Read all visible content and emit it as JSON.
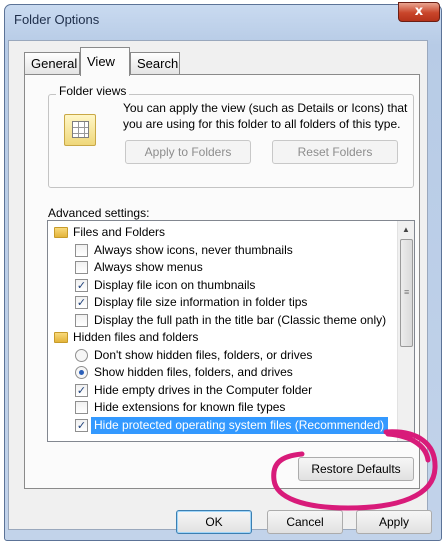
{
  "window": {
    "title": "Folder Options",
    "close_glyph": "x"
  },
  "tabs": [
    {
      "label": "General"
    },
    {
      "label": "View"
    },
    {
      "label": "Search"
    }
  ],
  "folder_views": {
    "legend": "Folder views",
    "description": "You can apply the view (such as Details or Icons) that you are using for this folder to all folders of this type.",
    "apply_button": "Apply to Folders",
    "reset_button": "Reset Folders"
  },
  "advanced": {
    "label": "Advanced settings:",
    "items": [
      {
        "kind": "folder",
        "label": "Files and Folders"
      },
      {
        "kind": "checkbox",
        "checked": false,
        "label": "Always show icons, never thumbnails"
      },
      {
        "kind": "checkbox",
        "checked": false,
        "label": "Always show menus"
      },
      {
        "kind": "checkbox",
        "checked": true,
        "label": "Display file icon on thumbnails"
      },
      {
        "kind": "checkbox",
        "checked": true,
        "label": "Display file size information in folder tips"
      },
      {
        "kind": "checkbox",
        "checked": false,
        "label": "Display the full path in the title bar (Classic theme only)"
      },
      {
        "kind": "folder",
        "label": "Hidden files and folders"
      },
      {
        "kind": "radio",
        "checked": false,
        "label": "Don't show hidden files, folders, or drives"
      },
      {
        "kind": "radio",
        "checked": true,
        "label": "Show hidden files, folders, and drives"
      },
      {
        "kind": "checkbox",
        "checked": true,
        "label": "Hide empty drives in the Computer folder"
      },
      {
        "kind": "checkbox",
        "checked": false,
        "label": "Hide extensions for known file types"
      },
      {
        "kind": "checkbox",
        "checked": true,
        "selected": true,
        "label": "Hide protected operating system files (Recommended)"
      }
    ]
  },
  "buttons": {
    "restore_defaults": "Restore Defaults",
    "ok": "OK",
    "cancel": "Cancel",
    "apply": "Apply"
  },
  "colors": {
    "selection": "#3399ff",
    "annotation_ring": "#d81b7a"
  }
}
